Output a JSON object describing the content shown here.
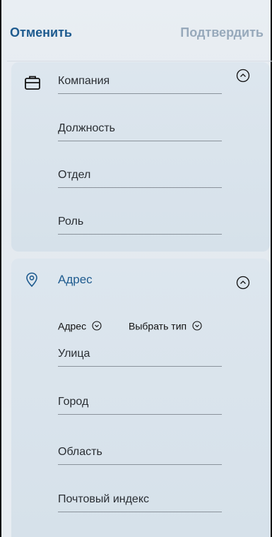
{
  "header": {
    "cancel_label": "Отменить",
    "confirm_label": "Подтвердить"
  },
  "work_section": {
    "icon": "briefcase-icon",
    "fields": {
      "company": "Компания",
      "position": "Должность",
      "department": "Отдел",
      "role": "Роль"
    }
  },
  "address_section": {
    "icon": "location-pin-icon",
    "title": "Адрес",
    "type_selector_label": "Адрес",
    "choose_type_label": "Выбрать тип",
    "fields": {
      "street": "Улица",
      "city": "Город",
      "region": "Область",
      "postal_code": "Почтовый индекс"
    }
  },
  "colors": {
    "accent": "#1e5b8f",
    "disabled": "#97a9bb",
    "card_bg": "#d9e3ec"
  }
}
